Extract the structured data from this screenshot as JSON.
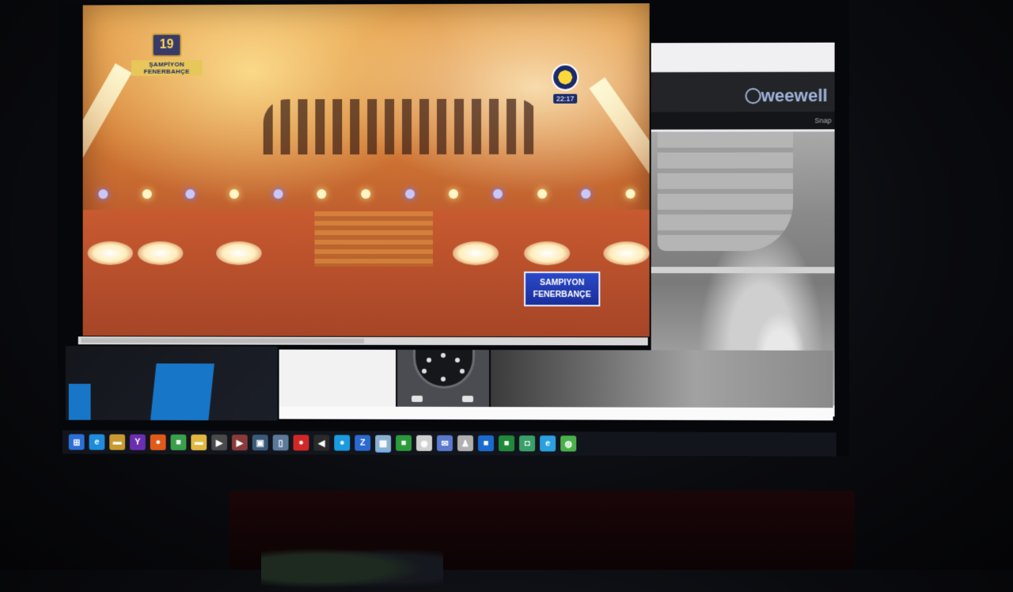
{
  "tv": {
    "logo_number": "19",
    "logo_text": "ŞAMPİYON FENERBAHÇE",
    "clock": "22:17",
    "banner_line1": "SAMPIYON",
    "banner_line2": "FENERBANÇE"
  },
  "browser": {
    "brand": "weewell",
    "sub_label": "Snap"
  },
  "taskbar": {
    "items": [
      {
        "icon": "start-icon",
        "glyph": "⊞",
        "color": "#2b6fd6"
      },
      {
        "icon": "edge-icon",
        "glyph": "e",
        "color": "#1e8bdb"
      },
      {
        "icon": "folder-icon",
        "glyph": "▬",
        "color": "#c99a32"
      },
      {
        "icon": "yahoo-icon",
        "glyph": "Y",
        "color": "#6a2fb0"
      },
      {
        "icon": "firefox-icon",
        "glyph": "●",
        "color": "#e05a1a"
      },
      {
        "icon": "app-icon",
        "glyph": "■",
        "color": "#3aa04a"
      },
      {
        "icon": "explorer-icon",
        "glyph": "▬",
        "color": "#e0b840"
      },
      {
        "icon": "media-icon",
        "glyph": "▶",
        "color": "#4a4a4a"
      },
      {
        "icon": "player-icon",
        "glyph": "▶",
        "color": "#8a3a3a"
      },
      {
        "icon": "window-icon",
        "glyph": "▣",
        "color": "#3a5a7a"
      },
      {
        "icon": "remote-icon",
        "glyph": "▯",
        "color": "#5a7a9a"
      },
      {
        "icon": "red-app-icon",
        "glyph": "●",
        "color": "#d02828"
      },
      {
        "icon": "arrow-icon",
        "glyph": "◀",
        "color": "#2a2a2a"
      },
      {
        "icon": "skype-icon",
        "glyph": "●",
        "color": "#1a9ae0"
      },
      {
        "icon": "zip-icon",
        "glyph": "Z",
        "color": "#2a6ad0"
      },
      {
        "icon": "active-window-icon",
        "glyph": "▦",
        "color": "#8ab0d0"
      },
      {
        "icon": "green-app-icon",
        "glyph": "■",
        "color": "#2a9a3a"
      },
      {
        "icon": "chrome-icon",
        "glyph": "◉",
        "color": "#d0d0d0"
      },
      {
        "icon": "mail-icon",
        "glyph": "✉",
        "color": "#5a7ad0"
      },
      {
        "icon": "user-icon",
        "glyph": "♟",
        "color": "#b0b0b0"
      },
      {
        "icon": "outlook-icon",
        "glyph": "■",
        "color": "#1a6ad0"
      },
      {
        "icon": "excel-icon",
        "glyph": "■",
        "color": "#1f8a3a"
      },
      {
        "icon": "camera-icon",
        "glyph": "◘",
        "color": "#3aa06a"
      },
      {
        "icon": "ie-icon",
        "glyph": "e",
        "color": "#2aa0e0"
      },
      {
        "icon": "globe-icon",
        "glyph": "◍",
        "color": "#4ab04a"
      }
    ]
  }
}
